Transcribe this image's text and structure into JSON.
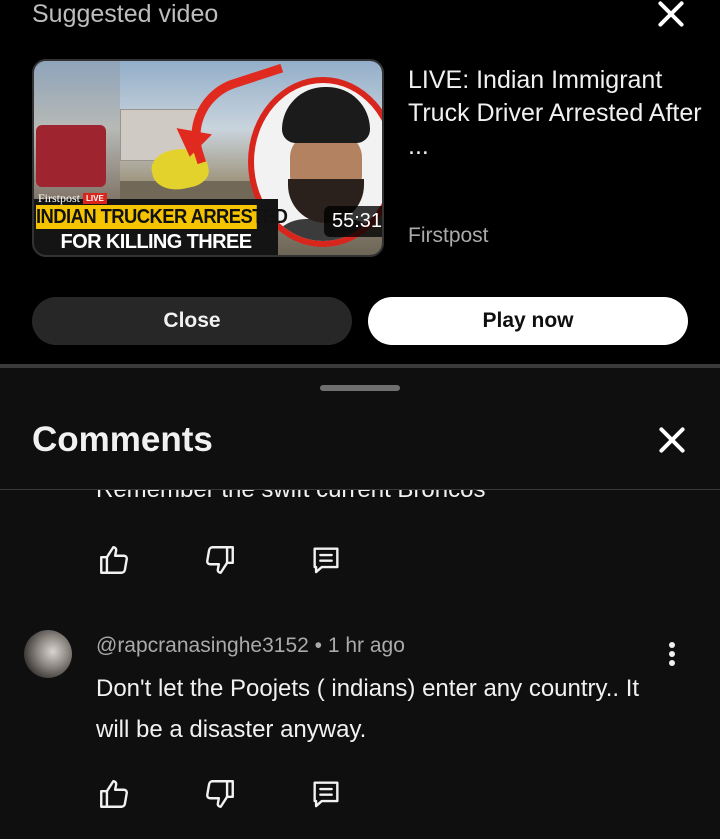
{
  "suggested": {
    "heading": "Suggested video",
    "video": {
      "title": "LIVE: Indian Immigrant Truck Driver Arrested After ...",
      "channel": "Firstpost",
      "duration": "55:31",
      "thumbnail": {
        "brand": "Firstpost",
        "live_badge": "LIVE",
        "headline_line1": "INDIAN TRUCKER ARRESTED",
        "headline_line2": "FOR KILLING THREE"
      }
    },
    "buttons": {
      "close": "Close",
      "play": "Play now"
    }
  },
  "comments": {
    "heading": "Comments",
    "previous_comment_tail": "Remember the swift current Broncos",
    "items": [
      {
        "author": "@rapcranasinghe3152",
        "time": "1 hr ago",
        "separator": "•",
        "text": "Don't let the Poojets ( indians) enter any country.. It will be a disaster anyway."
      }
    ]
  },
  "icons": {
    "close": "close-icon",
    "like": "thumbs-up-icon",
    "dislike": "thumbs-down-icon",
    "reply": "reply-icon",
    "more": "more-vert-icon"
  },
  "colors": {
    "background": "#0f0f0f",
    "panel": "#000000",
    "secondary_text": "#aaaaaa",
    "accent_red": "#d9261d",
    "headline_yellow": "#f5c400"
  }
}
